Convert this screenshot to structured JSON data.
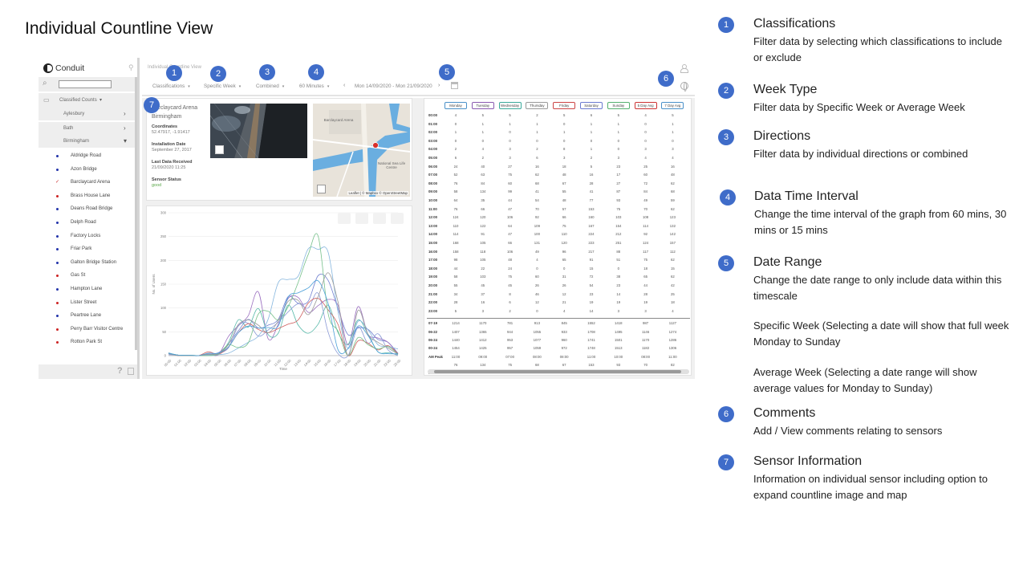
{
  "slide": {
    "title": "Individual Countline View"
  },
  "app": {
    "logo": "Conduit",
    "breadcrumb": "Individual Countline View",
    "sidebar": {
      "search_placeholder": "",
      "folder": "Classified Counts",
      "regions": [
        "Aylesbury",
        "Bath",
        "Birmingham"
      ],
      "sites": [
        {
          "name": "Aldridge Road",
          "color": "#2233aa"
        },
        {
          "name": "Azon Bridge",
          "color": "#2233aa"
        },
        {
          "name": "Barclaycard Arena",
          "color": "#cc2222",
          "selected": true
        },
        {
          "name": "Brass House Lane",
          "color": "#cc2222"
        },
        {
          "name": "Deans Road Bridge",
          "color": "#2233aa"
        },
        {
          "name": "Delph Road",
          "color": "#2233aa"
        },
        {
          "name": "Factory Locks",
          "color": "#2233aa"
        },
        {
          "name": "Friar Park",
          "color": "#2233aa"
        },
        {
          "name": "Galton Bridge Station",
          "color": "#2233aa"
        },
        {
          "name": "Gas St",
          "color": "#cc2222"
        },
        {
          "name": "Hampton Lane",
          "color": "#2233aa"
        },
        {
          "name": "Lister Street",
          "color": "#cc2222"
        },
        {
          "name": "Peartree Lane",
          "color": "#2233aa"
        },
        {
          "name": "Perry Barr Visitor Centre",
          "color": "#cc2222"
        },
        {
          "name": "Rotton Park St",
          "color": "#cc2222"
        }
      ]
    },
    "filters": {
      "classifications": "Classifications",
      "week_type": "Specific Week",
      "direction": "Combined",
      "interval": "60 Minutes",
      "date_range": "Mon 14/09/2020 - Mon 21/09/2020"
    },
    "sensor": {
      "name_line1": "Barclaycard Arena",
      "name_line2": "Birmingham",
      "coordinates_label": "Coordinates",
      "coordinates": "52.47917, -1.91417",
      "installation_label": "Installation Date",
      "installation": "September 27, 2017",
      "last_data_label": "Last Data Received",
      "last_data": "21/09/2020 11:25",
      "status_label": "Sensor Status",
      "status": "good"
    },
    "map": {
      "attribution": "Leaflet | © Mapbox © OpenStreetMap",
      "labels": [
        "Barclaycard Arena",
        "National Sea Life Centre"
      ]
    },
    "chart_data": {
      "type": "line",
      "title": "",
      "xlabel": "Time",
      "ylabel": "No. of Users",
      "ylim": [
        0,
        300
      ],
      "yticks": [
        0,
        50,
        100,
        150,
        200,
        250,
        300
      ],
      "categories": [
        "00:00",
        "01:00",
        "02:00",
        "03:00",
        "04:00",
        "05:00",
        "06:00",
        "07:00",
        "08:00",
        "09:00",
        "10:00",
        "11:00",
        "12:00",
        "13:00",
        "14:00",
        "15:00",
        "16:00",
        "17:00",
        "18:00",
        "19:00",
        "20:00",
        "21:00",
        "22:00",
        "23:00"
      ],
      "series": [
        {
          "color": "#6f7fd0",
          "values": [
            4,
            1,
            1,
            0,
            2,
            6,
            24,
            52,
            76,
            58,
            64,
            76,
            124,
            110,
            114,
            168,
            158,
            98,
            44,
            58,
            55,
            34,
            28,
            5
          ]
        },
        {
          "color": "#9b6fc0",
          "values": [
            5,
            1,
            1,
            0,
            4,
            2,
            40,
            63,
            84,
            134,
            35,
            66,
            120,
            122,
            91,
            105,
            118,
            105,
            22,
            103,
            45,
            37,
            28,
            3
          ]
        },
        {
          "color": "#55b8a8",
          "values": [
            5,
            1,
            0,
            0,
            3,
            3,
            27,
            75,
            60,
            99,
            44,
            47,
            106,
            64,
            47,
            66,
            106,
            48,
            24,
            75,
            45,
            8,
            6,
            2
          ]
        },
        {
          "color": "#8c9bd6",
          "values": [
            2,
            1,
            1,
            0,
            2,
            6,
            16,
            62,
            68,
            41,
            54,
            70,
            92,
            109,
            100,
            131,
            49,
            4,
            0,
            60,
            26,
            46,
            12,
            0
          ]
        },
        {
          "color": "#d06060",
          "values": [
            5,
            0,
            1,
            0,
            8,
            3,
            18,
            48,
            67,
            55,
            48,
            57,
            66,
            75,
            110,
            120,
            96,
            65,
            0,
            31,
            26,
            12,
            21,
            4
          ]
        },
        {
          "color": "#86b6de",
          "values": [
            6,
            1,
            1,
            0,
            1,
            2,
            5,
            16,
            28,
            41,
            77,
            153,
            160,
            167,
            224,
            223,
            217,
            91,
            15,
            72,
            54,
            23,
            19,
            14
          ]
        },
        {
          "color": "#76c08a",
          "values": [
            5,
            1,
            1,
            0,
            0,
            3,
            23,
            17,
            27,
            87,
            93,
            75,
            103,
            154,
            212,
            251,
            88,
            51,
            0,
            38,
            23,
            14,
            19,
            3
          ]
        },
        {
          "color": "#999999",
          "values": [
            4,
            0,
            0,
            0,
            3,
            4,
            23,
            65,
            75,
            64,
            48,
            73,
            114,
            116,
            86,
            124,
            174,
            112,
            0,
            95,
            44,
            28,
            16,
            3
          ]
        },
        {
          "color": "#4a9fd8",
          "values": [
            5,
            1,
            1,
            0,
            5,
            5,
            18,
            48,
            62,
            58,
            59,
            62,
            123,
            132,
            142,
            157,
            109,
            12,
            15,
            62,
            42,
            8,
            4,
            4
          ]
        }
      ]
    },
    "table": {
      "days": [
        {
          "label": "Monday",
          "color": "#4a90c8"
        },
        {
          "label": "Tuesday",
          "color": "#8a5ab0"
        },
        {
          "label": "Wednesday",
          "color": "#3aa89a"
        },
        {
          "label": "Thursday",
          "color": "#999999"
        },
        {
          "label": "Friday",
          "color": "#cc4444"
        },
        {
          "label": "Saturday",
          "color": "#6a7ad0"
        },
        {
          "label": "Sunday",
          "color": "#55b070"
        },
        {
          "label": "5 Day Avg",
          "color": "#cc3333"
        },
        {
          "label": "7 Day Avg",
          "color": "#4a90c8"
        }
      ],
      "hours": [
        "00:00",
        "01:00",
        "02:00",
        "03:00",
        "04:00",
        "05:00",
        "06:00",
        "07:00",
        "08:00",
        "09:00",
        "10:00",
        "11:00",
        "12:00",
        "13:00",
        "14:00",
        "15:00",
        "16:00",
        "17:00",
        "18:00",
        "19:00",
        "20:00",
        "21:00",
        "22:00",
        "23:00"
      ],
      "rows": [
        [
          "4",
          "5",
          "5",
          "2",
          "5",
          "6",
          "5",
          "4",
          "5"
        ],
        [
          "0",
          "1",
          "1",
          "1",
          "0",
          "1",
          "1",
          "0",
          "1"
        ],
        [
          "1",
          "1",
          "0",
          "1",
          "1",
          "1",
          "1",
          "0",
          "1"
        ],
        [
          "0",
          "0",
          "0",
          "0",
          "0",
          "0",
          "0",
          "0",
          "0"
        ],
        [
          "2",
          "4",
          "3",
          "2",
          "8",
          "1",
          "0",
          "3",
          "3"
        ],
        [
          "6",
          "2",
          "3",
          "6",
          "3",
          "2",
          "3",
          "4",
          "4"
        ],
        [
          "24",
          "40",
          "27",
          "16",
          "18",
          "5",
          "23",
          "25",
          "16"
        ],
        [
          "52",
          "63",
          "75",
          "62",
          "48",
          "16",
          "17",
          "60",
          "48"
        ],
        [
          "76",
          "84",
          "60",
          "68",
          "67",
          "28",
          "27",
          "72",
          "62"
        ],
        [
          "58",
          "134",
          "99",
          "41",
          "55",
          "41",
          "87",
          "84",
          "68"
        ],
        [
          "64",
          "35",
          "44",
          "54",
          "48",
          "77",
          "93",
          "49",
          "59"
        ],
        [
          "76",
          "66",
          "47",
          "70",
          "57",
          "153",
          "75",
          "70",
          "62"
        ],
        [
          "124",
          "120",
          "106",
          "92",
          "66",
          "160",
          "103",
          "108",
          "123"
        ],
        [
          "110",
          "122",
          "64",
          "109",
          "75",
          "167",
          "154",
          "114",
          "132"
        ],
        [
          "114",
          "91",
          "47",
          "100",
          "110",
          "224",
          "212",
          "92",
          "142"
        ],
        [
          "168",
          "105",
          "66",
          "131",
          "120",
          "223",
          "251",
          "124",
          "157"
        ],
        [
          "158",
          "118",
          "106",
          "49",
          "96",
          "217",
          "88",
          "117",
          "112"
        ],
        [
          "98",
          "105",
          "48",
          "4",
          "65",
          "91",
          "51",
          "75",
          "62"
        ],
        [
          "44",
          "22",
          "24",
          "0",
          "0",
          "15",
          "0",
          "18",
          "15"
        ],
        [
          "58",
          "103",
          "75",
          "60",
          "31",
          "72",
          "38",
          "65",
          "62"
        ],
        [
          "55",
          "45",
          "45",
          "26",
          "26",
          "54",
          "23",
          "44",
          "42"
        ],
        [
          "34",
          "37",
          "8",
          "46",
          "12",
          "23",
          "14",
          "28",
          "25"
        ],
        [
          "28",
          "16",
          "6",
          "12",
          "21",
          "19",
          "19",
          "19",
          "18"
        ],
        [
          "5",
          "3",
          "2",
          "0",
          "4",
          "14",
          "3",
          "3",
          "4"
        ]
      ],
      "summary_labels": [
        "07-19",
        "06-22",
        "06-24",
        "00-24",
        "AM Peak",
        "",
        "PM Peak",
        ""
      ],
      "summary_rows": [
        [
          "1214",
          "1170",
          "781",
          "913",
          "845",
          "1552",
          "1418",
          "987",
          "1127"
        ],
        [
          "1407",
          "1365",
          "944",
          "1055",
          "933",
          "1708",
          "1495",
          "1146",
          "1274"
        ],
        [
          "1440",
          "1412",
          "953",
          "1077",
          "960",
          "1741",
          "1501",
          "1170",
          "1286"
        ],
        [
          "1454",
          "1425",
          "957",
          "1059",
          "972",
          "1748",
          "1513",
          "1182",
          "1306"
        ],
        [
          "11:00",
          "09:00",
          "07:00",
          "08:00",
          "08:00",
          "11:00",
          "10:00",
          "08:00",
          "11:00"
        ],
        [
          "76",
          "134",
          "75",
          "68",
          "67",
          "153",
          "93",
          "70",
          "82"
        ],
        [
          "17:00",
          "17:00",
          "12:00",
          "16:00",
          "18:00",
          "15:00",
          "15:00",
          "16:00",
          "16:00"
        ],
        [
          "172",
          "158",
          "106",
          "131",
          "128",
          "249",
          "251",
          "124",
          "157"
        ]
      ]
    }
  },
  "legend": [
    {
      "num": "1",
      "title": "Classifications",
      "desc": "Filter data by selecting which classifications to include or exclude"
    },
    {
      "num": "2",
      "title": "Week Type",
      "desc": "Filter data by Specific Week or Average Week"
    },
    {
      "num": "3",
      "title": "Directions",
      "desc": "Filter data by individual directions or combined"
    },
    {
      "num": "4",
      "title": "Data Time Interval",
      "desc": "Change the time interval of the graph from 60 mins, 30 mins or 15 mins"
    },
    {
      "num": "5",
      "title": "Date Range",
      "desc": "Change the date range to only include data within this timescale",
      "extra1": "Specific Week (Selecting a date will show that full week Monday to Sunday",
      "extra2": "Average Week (Selecting a date range will show average values for Monday to Sunday)"
    },
    {
      "num": "6",
      "title": "Comments",
      "desc": "Add / View comments relating to sensors"
    },
    {
      "num": "7",
      "title": "Sensor Information",
      "desc": "Information on individual sensor including option to expand countline image and map"
    }
  ]
}
